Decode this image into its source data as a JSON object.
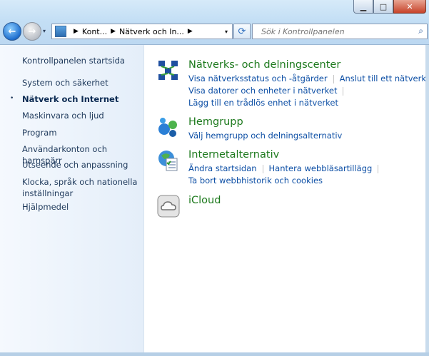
{
  "window": {
    "minimize_glyph": "▁",
    "maximize_glyph": "□",
    "close_glyph": "✕"
  },
  "navigation": {
    "back_glyph": "←",
    "forward_glyph": "→",
    "dropdown_glyph": "▾"
  },
  "address": {
    "crumbs": [
      "Kont...",
      "Nätverk och In..."
    ],
    "separator": "▶",
    "dropdown_glyph": "▾",
    "refresh_glyph": "⟳"
  },
  "search": {
    "placeholder": "Sök i Kontrollpanelen",
    "icon_glyph": "⌕"
  },
  "sidebar": {
    "items": [
      {
        "label": "Kontrollpanelen startsida"
      },
      {
        "label": "System och säkerhet"
      },
      {
        "label": "Nätverk och Internet"
      },
      {
        "label": "Maskinvara och ljud"
      },
      {
        "label": "Program"
      },
      {
        "label": "Användarkonton och barnspärr"
      },
      {
        "label": "Utseende och anpassning"
      },
      {
        "label": "Klocka, språk och nationella inställningar"
      },
      {
        "label": "Hjälpmedel"
      }
    ],
    "active_bullet": "•"
  },
  "main": {
    "sections": [
      {
        "title": "Nätverks- och delningscenter",
        "icon": "network-center-icon",
        "links": [
          [
            "Visa nätverksstatus och -åtgärder",
            "Anslut till ett nätverk"
          ],
          [
            "Visa datorer och enheter i nätverket"
          ],
          [
            "Lägg till en trådlös enhet i nätverket"
          ]
        ]
      },
      {
        "title": "Hemgrupp",
        "icon": "homegroup-icon",
        "links": [
          [
            "Välj hemgrupp och delningsalternativ"
          ]
        ]
      },
      {
        "title": "Internetalternativ",
        "icon": "internet-options-icon",
        "links": [
          [
            "Ändra startsidan",
            "Hantera webbläsartillägg"
          ],
          [
            "Ta bort webbhistorik och cookies"
          ]
        ]
      },
      {
        "title": "iCloud",
        "icon": "icloud-icon",
        "links": []
      }
    ]
  },
  "colors": {
    "section_title": "#1e7a1e",
    "link": "#0d4fa5",
    "sidebar_text": "#1e395b"
  }
}
